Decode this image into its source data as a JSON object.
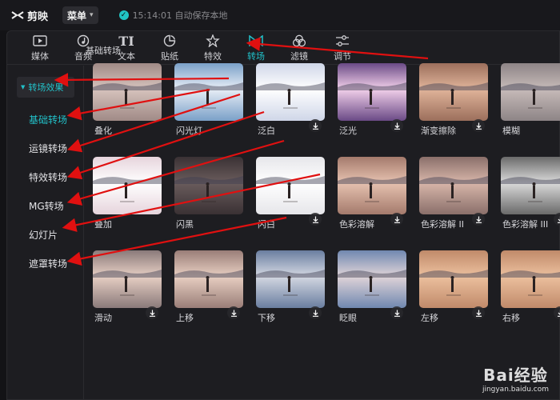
{
  "app": {
    "name": "剪映",
    "menu_label": "菜单",
    "save_status": "15:14:01 自动保存本地"
  },
  "tabs": [
    {
      "label": "媒体",
      "icon": "media-icon"
    },
    {
      "label": "音频",
      "icon": "audio-icon"
    },
    {
      "label": "文本",
      "icon": "text-icon"
    },
    {
      "label": "贴纸",
      "icon": "sticker-icon"
    },
    {
      "label": "特效",
      "icon": "effects-icon"
    },
    {
      "label": "转场",
      "icon": "transition-icon"
    },
    {
      "label": "滤镜",
      "icon": "filter-icon"
    },
    {
      "label": "调节",
      "icon": "adjust-icon"
    }
  ],
  "active_tab": "转场",
  "sidebar": {
    "header": "转场效果",
    "items": [
      "基础转场",
      "运镜转场",
      "特效转场",
      "MG转场",
      "幻灯片",
      "遮罩转场"
    ],
    "active_item": "基础转场"
  },
  "section_title": "基础转场",
  "transitions": [
    {
      "label": "叠化",
      "download": false
    },
    {
      "label": "闪光灯",
      "download": false
    },
    {
      "label": "泛白",
      "download": true
    },
    {
      "label": "泛光",
      "download": true
    },
    {
      "label": "渐变擦除",
      "download": true
    },
    {
      "label": "模糊",
      "download": false
    },
    {
      "label": "叠加",
      "download": false
    },
    {
      "label": "闪黑",
      "download": false
    },
    {
      "label": "闪白",
      "download": true
    },
    {
      "label": "色彩溶解",
      "download": true
    },
    {
      "label": "色彩溶解 II",
      "download": true
    },
    {
      "label": "色彩溶解 III",
      "download": true
    },
    {
      "label": "滑动",
      "download": true
    },
    {
      "label": "上移",
      "download": true
    },
    {
      "label": "下移",
      "download": true
    },
    {
      "label": "眨眼",
      "download": true
    },
    {
      "label": "左移",
      "download": true
    },
    {
      "label": "右移",
      "download": true
    }
  ],
  "watermark": {
    "brand": "Bai经验",
    "url": "jingyan.baidu.com"
  },
  "colors": {
    "accent": "#22c1c9",
    "annotation": "#e01010"
  }
}
